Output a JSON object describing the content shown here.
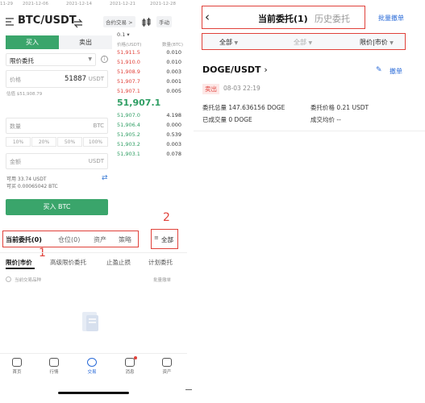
{
  "left": {
    "dates": [
      "11-29",
      "2021-12-06",
      "2021-12-14",
      "2021-12-21",
      "2021-12-28"
    ],
    "pair": "BTC/USDT",
    "swap_icon": "swap-icon",
    "contract_label": "合约交易 >",
    "manual_label": "手动",
    "buy_tab": "买入",
    "sell_tab": "卖出",
    "order_type": "限价委托",
    "price_label": "价格",
    "price_value": "51887",
    "price_unit": "USDT",
    "estimate": "估值 $51,908.79",
    "qty_label": "数量",
    "qty_unit": "BTC",
    "pcts": [
      "10%",
      "20%",
      "50%",
      "100%"
    ],
    "amount_label": "金额",
    "amount_unit": "USDT",
    "avail_usdt": "可用 33.74 USDT",
    "avail_btc": "可买 0.00065042 BTC",
    "buy_button": "买入 BTC",
    "ob_step": "0.1",
    "ob_price_hdr": "价格(USDT)",
    "ob_qty_hdr": "数量(BTC)",
    "asks": [
      {
        "p": "51,911.5",
        "q": "0.010"
      },
      {
        "p": "51,910.0",
        "q": "0.010"
      },
      {
        "p": "51,908.9",
        "q": "0.003"
      },
      {
        "p": "51,907.7",
        "q": "0.001"
      },
      {
        "p": "51,907.1",
        "q": "0.005"
      }
    ],
    "last_price": "51,907.1",
    "bids": [
      {
        "p": "51,907.0",
        "q": "4.198"
      },
      {
        "p": "51,906.4",
        "q": "0.000"
      },
      {
        "p": "51,905.2",
        "q": "0.539"
      },
      {
        "p": "51,903.2",
        "q": "0.003"
      },
      {
        "p": "51,903.1",
        "q": "0.078"
      }
    ],
    "bottom_tabs": [
      "当前委托(0)",
      "仓位(0)",
      "资产",
      "策略"
    ],
    "all_label": "全部",
    "order_tabs": [
      "限价|市价",
      "高级限价委托",
      "止盈止损",
      "计划委托"
    ],
    "current_pair_only": "当前交易品种",
    "batch_cancel": "批量撤单",
    "nav": [
      "首页",
      "行情",
      "交易",
      "消息",
      "资产"
    ],
    "annot1": "1",
    "annot2": "2"
  },
  "right": {
    "back_icon": "back-chevron-icon",
    "tab_current": "当前委托(1)",
    "tab_history": "历史委托",
    "batch_cancel": "批量撤单",
    "filter_all": "全部",
    "filter_mid": "全部",
    "filter_type": "限价|市价",
    "order": {
      "pair": "DOGE/USDT",
      "side": "卖出",
      "time": "08-03 22:19",
      "edit_icon": "edit-icon",
      "cancel": "撤单",
      "amount": "委托总量 147.636156 DOGE",
      "price": "委托价格 0.21 USDT",
      "filled": "已成交量 0 DOGE",
      "avg": "成交均价 --"
    }
  }
}
